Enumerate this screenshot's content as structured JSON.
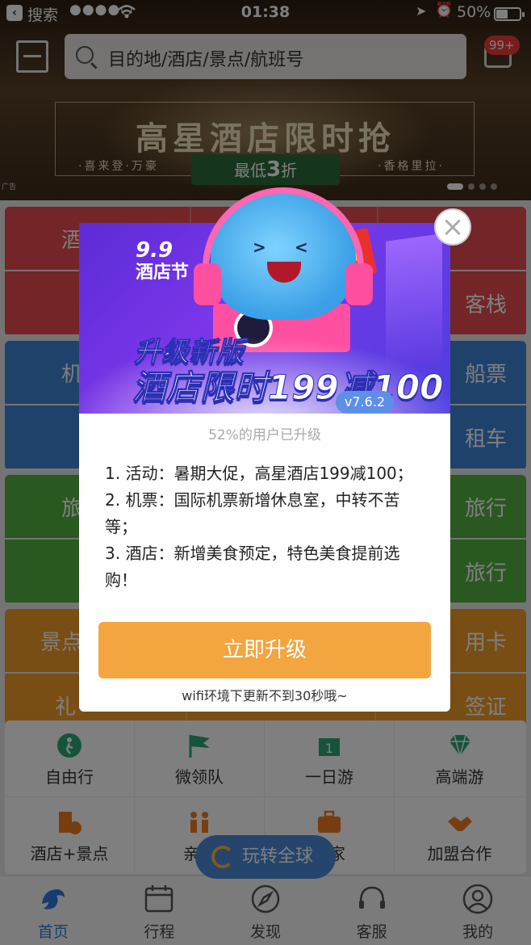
{
  "status_bar": {
    "back_glyph": "‹",
    "carrier": "搜索",
    "signal": "●●●●○",
    "time": "01:38",
    "battery_pct": "50%",
    "battery_level": 0.5
  },
  "header": {
    "search_placeholder": "目的地/酒店/景点/航班号",
    "message_badge": "99+"
  },
  "banner": {
    "title": "高星酒店限时抢",
    "left_brands": "·喜来登·万豪",
    "right_brands": "·香格里拉·",
    "discount_prefix": "最低",
    "discount_value": "3",
    "discount_suffix": "折",
    "ad_tag": "广告"
  },
  "grid": {
    "red": [
      "酒",
      "客栈"
    ],
    "blue": [
      "机",
      "船票",
      "租车"
    ],
    "green": [
      "旅",
      "旅行",
      "旅行"
    ],
    "orange": [
      "景点",
      "用卡",
      "礼",
      "签证"
    ]
  },
  "tools": [
    {
      "label": "自由行",
      "icon": "hiker-icon"
    },
    {
      "label": "微领队",
      "icon": "flag-icon"
    },
    {
      "label": "一日游",
      "icon": "calendar-one-icon"
    },
    {
      "label": "高端游",
      "icon": "diamond-icon"
    },
    {
      "label": "酒店+景点",
      "icon": "hotel-scenic-icon"
    },
    {
      "label": "亲子",
      "icon": "family-icon"
    },
    {
      "label": "管家",
      "icon": "suitcase-icon"
    },
    {
      "label": "加盟合作",
      "icon": "handshake-icon"
    }
  ],
  "float_button": "玩转全球",
  "tabbar": [
    {
      "label": "首页",
      "active": true
    },
    {
      "label": "行程",
      "active": false
    },
    {
      "label": "发现",
      "active": false
    },
    {
      "label": "客服",
      "active": false
    },
    {
      "label": "我的",
      "active": false
    }
  ],
  "modal": {
    "fest_number": "9.9",
    "fest_name": "酒店节",
    "headline_line1": "升级新版",
    "headline_line2": "酒店限时199减100",
    "version": "v7.6.2",
    "upgrade_ratio": "52%的用户已升级",
    "notes": [
      "1. 活动：暑期大促，高星酒店199减100；",
      "2. 机票：国际机票新增休息室，中转不苦等；",
      "3. 酒店：新增美食预定，特色美食提前选购！"
    ],
    "upgrade_button": "立即升级",
    "wifi_tip": "wifi环境下更新不到30秒哦~",
    "close_glyph": "×"
  },
  "colors": {
    "accent_blue": "#2b7be0",
    "upgrade_orange": "#f3a540",
    "badge_red": "#f03a3a"
  }
}
